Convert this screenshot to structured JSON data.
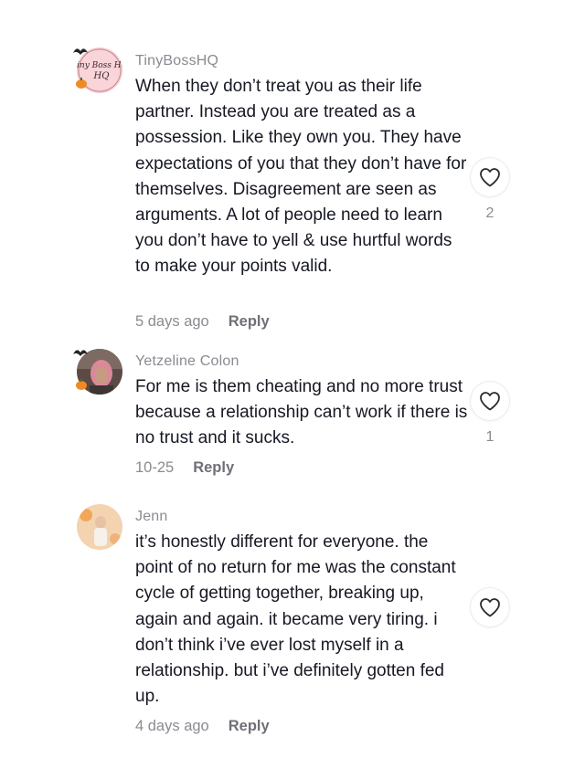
{
  "comments": [
    {
      "username": "TinyBossHQ",
      "avatar_text": "Tiny Boss HQ",
      "text": "When they don’t treat you as their life partner. Instead you are treated as a possession. Like they own you. They have expectations of you that they don’t have for themselves. Disagreement are seen as arguments. A lot of people need to learn you don’t have to yell & use hurtful words to make your points valid.",
      "date": "5 days ago",
      "reply_label": "Reply",
      "like_count": "2",
      "like_icon": "heart-outline-icon"
    },
    {
      "username": "Yetzeline Colon",
      "text": "For me is them cheating and no more trust because a relationship can’t work if there is no trust and it sucks.",
      "date": "10-25",
      "reply_label": "Reply",
      "like_count": "1",
      "like_icon": "heart-outline-icon"
    },
    {
      "username": "Jenn",
      "text": "it’s honestly different for everyone. the point of no return for me was the constant cycle of getting together, breaking up, again and again. it became very tiring. i don’t think i’ve ever lost myself in a relationship. but i’ve definitely gotten fed up.",
      "date": "4 days ago",
      "reply_label": "Reply",
      "like_count": "",
      "like_icon": "heart-outline-icon"
    }
  ],
  "colors": {
    "text": "#161823",
    "muted": "#8a8b91",
    "background": "#ffffff",
    "accent_orange": "#f08a24"
  }
}
